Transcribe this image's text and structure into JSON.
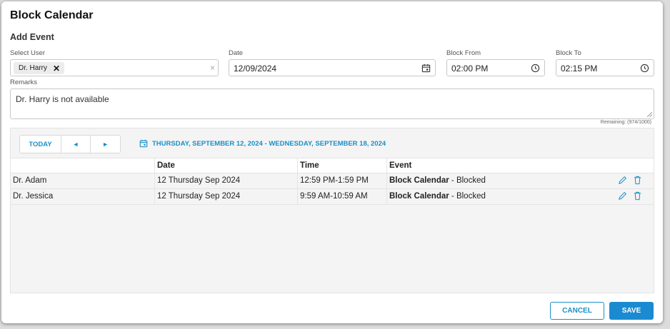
{
  "dialog": {
    "title": "Block Calendar",
    "subtitle": "Add Event"
  },
  "form": {
    "select_user": {
      "label": "Select User",
      "chip": "Dr. Harry",
      "chip_remove": "✕",
      "clear": "×"
    },
    "date": {
      "label": "Date",
      "value": "12/09/2024"
    },
    "block_from": {
      "label": "Block From",
      "value": "02:00 PM"
    },
    "block_to": {
      "label": "Block To",
      "value": "02:15 PM"
    },
    "remarks": {
      "label": "Remarks",
      "value": "Dr. Harry is not available",
      "remaining": "Remaining: (974/1000)"
    }
  },
  "calendar": {
    "today_label": "TODAY",
    "prev_icon": "◂",
    "next_icon": "▸",
    "range_label": "THURSDAY, SEPTEMBER 12, 2024 - WEDNESDAY, SEPTEMBER 18, 2024",
    "columns": [
      "",
      "Date",
      "Time",
      "Event"
    ],
    "rows": [
      {
        "user": "Dr. Adam",
        "date": "12 Thursday Sep 2024",
        "time": "12:59 PM-1:59 PM",
        "event_bold": "Block Calendar",
        "event_rest": " - Blocked"
      },
      {
        "user": "Dr. Jessica",
        "date": "12 Thursday Sep 2024",
        "time": "9:59 AM-10:59 AM",
        "event_bold": "Block Calendar",
        "event_rest": " - Blocked"
      }
    ]
  },
  "footer": {
    "cancel": "CANCEL",
    "save": "SAVE"
  },
  "colors": {
    "accent": "#1b8fc7",
    "save_bg": "#1a8bd0"
  }
}
